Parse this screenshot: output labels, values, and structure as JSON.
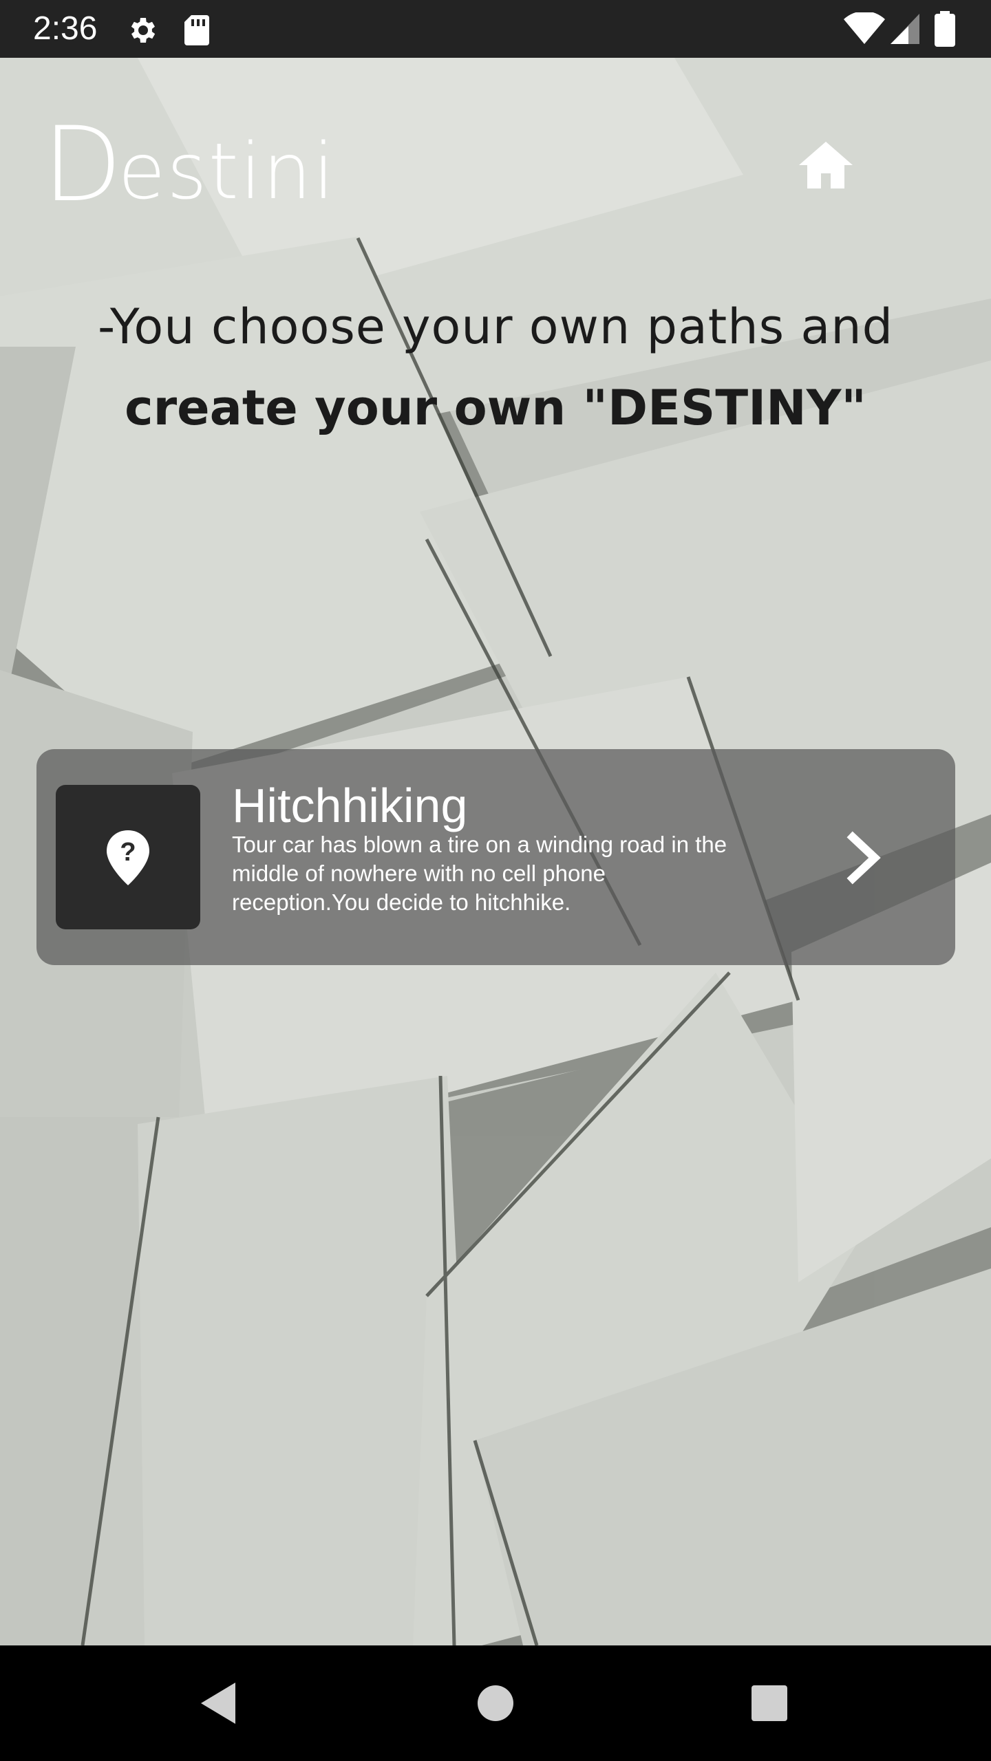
{
  "status_bar": {
    "time": "2:36",
    "icons": [
      "gear-icon",
      "sd-card-icon",
      "wifi-icon",
      "cell-signal-icon",
      "battery-icon"
    ]
  },
  "header": {
    "logo_initial": "D",
    "logo_rest": "estini",
    "home_icon": "home-icon"
  },
  "tagline": {
    "line1": "-You choose your own paths and",
    "line2": "create your own \"DESTINY\""
  },
  "story_card": {
    "title": "Hitchhiking",
    "description": "Tour car has blown a tire on a winding road in the middle of nowhere with no cell phone reception.You decide to hitchhike.",
    "thumb_icon": "location-question-icon",
    "arrow_icon": "chevron-right-icon"
  },
  "nav_bar": {
    "buttons": [
      "back-icon",
      "home-circle-icon",
      "recents-icon"
    ]
  },
  "colors": {
    "status_bar": "#232323",
    "card_background": "#5a5a5a",
    "thumb_background": "#2b2b2b",
    "nav_bar": "#000000"
  }
}
